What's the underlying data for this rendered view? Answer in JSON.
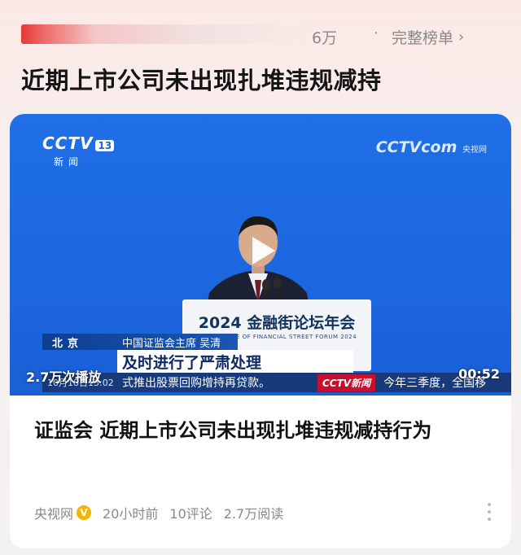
{
  "top": {
    "heat_count": "6万",
    "separator": "·",
    "full_list_label": "完整榜单",
    "full_list_icon": "chevron-right-icon"
  },
  "topic": {
    "title": "近期上市公司未出现扎堆违规减持"
  },
  "video": {
    "channel_logo": "CCTV",
    "channel_number": "13",
    "channel_sub": "新闻",
    "watermark": "CCTV",
    "watermark_sub": "com",
    "watermark_cn": "央视网",
    "podium_title": "2024 金融街论坛年会",
    "podium_subtitle": "CONFERENCE OF FINANCIAL STREET FORUM 2024",
    "location": "北京",
    "speaker": "中国证监会主席  吴清",
    "caption": "及时进行了严肃处理",
    "timestamp": "10月18日13:02",
    "ticker": "式推出股票回购增持再贷款。",
    "ticker_logo": "CCTV新闻",
    "ticker_tail": "今年三季度，全国移",
    "play_count": "2.7万次播放",
    "duration": "00:52",
    "play_icon": "play-icon"
  },
  "article": {
    "headline": "证监会 近期上市公司未出现扎堆违规减持行为",
    "source": "央视网",
    "verified_badge": "V",
    "time": "20小时前",
    "comments": "10评论",
    "reads": "2.7万阅读"
  },
  "colors": {
    "video_bg": "#1c67e0",
    "heat_accent": "#e53935",
    "badge": "#f5b400"
  }
}
